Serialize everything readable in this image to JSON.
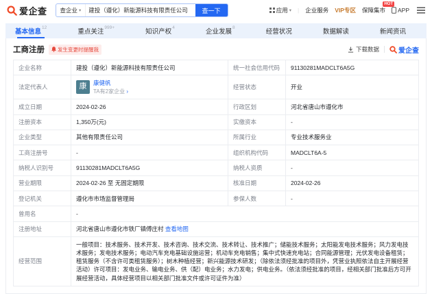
{
  "header": {
    "logo_text": "爱企查",
    "search": {
      "category": "查企业",
      "value": "建投（遵化）新能源科技有限责任公司",
      "button": "查一下"
    },
    "nav": {
      "apps": "应用",
      "enterprise": "企业服务",
      "vip": "VIP专区",
      "market": "保障集市",
      "market_badge": "HOT",
      "app": "APP"
    }
  },
  "tabs": [
    {
      "label": "基本信息",
      "count": "12",
      "active": true
    },
    {
      "label": "重点关注",
      "count": "999+",
      "active": false
    },
    {
      "label": "知识产权",
      "count": "4",
      "active": false
    },
    {
      "label": "企业发展",
      "count": "8",
      "active": false
    },
    {
      "label": "经营状况",
      "count": "",
      "active": false
    },
    {
      "label": "数据解读",
      "count": "",
      "active": false
    },
    {
      "label": "新闻资讯",
      "count": "",
      "active": false
    }
  ],
  "section": {
    "title": "工商注册",
    "reminder": "发生变更时提醒我",
    "download": "下载数据",
    "brand": "爱企查"
  },
  "registration": {
    "rows": [
      [
        {
          "kind": "label",
          "text": "企业名称"
        },
        {
          "kind": "text",
          "text": "建投（遵化）新能源科技有限责任公司"
        },
        {
          "kind": "label",
          "text": "统一社会信用代码"
        },
        {
          "kind": "text",
          "text": "91130281MADCLT6A5G"
        }
      ],
      [
        {
          "kind": "label",
          "text": "法定代表人"
        },
        {
          "kind": "person",
          "avatar": "康",
          "name": "康健帆",
          "sub": "TA有2家企业"
        },
        {
          "kind": "label",
          "text": "经营状态"
        },
        {
          "kind": "text",
          "text": "开业"
        }
      ],
      [
        {
          "kind": "label",
          "text": "成立日期"
        },
        {
          "kind": "text",
          "text": "2024-02-26"
        },
        {
          "kind": "label",
          "text": "行政区划"
        },
        {
          "kind": "text",
          "text": "河北省唐山市遵化市"
        }
      ],
      [
        {
          "kind": "label",
          "text": "注册资本"
        },
        {
          "kind": "text",
          "text": "1,350万(元)"
        },
        {
          "kind": "label",
          "text": "实缴资本"
        },
        {
          "kind": "text",
          "text": "-"
        }
      ],
      [
        {
          "kind": "label",
          "text": "企业类型"
        },
        {
          "kind": "text",
          "text": "其他有限责任公司"
        },
        {
          "kind": "label",
          "text": "所属行业"
        },
        {
          "kind": "text",
          "text": "专业技术服务业"
        }
      ],
      [
        {
          "kind": "label",
          "text": "工商注册号"
        },
        {
          "kind": "text",
          "text": "-"
        },
        {
          "kind": "label",
          "text": "组织机构代码"
        },
        {
          "kind": "text",
          "text": "MADCLT6A-5"
        }
      ],
      [
        {
          "kind": "label",
          "text": "纳税人识别号"
        },
        {
          "kind": "text",
          "text": "91130281MADCLT6A5G"
        },
        {
          "kind": "label",
          "text": "纳税人资质"
        },
        {
          "kind": "text",
          "text": "-"
        }
      ],
      [
        {
          "kind": "label",
          "text": "营业期限"
        },
        {
          "kind": "text",
          "text": "2024-02-26 至 无固定期限"
        },
        {
          "kind": "label",
          "text": "核准日期"
        },
        {
          "kind": "text",
          "text": "2024-02-26"
        }
      ],
      [
        {
          "kind": "label",
          "text": "登记机关"
        },
        {
          "kind": "text",
          "text": "遵化市市场监督管理局"
        },
        {
          "kind": "label",
          "text": "参保人数"
        },
        {
          "kind": "text",
          "text": "-"
        }
      ],
      [
        {
          "kind": "label",
          "text": "曾用名"
        },
        {
          "kind": "text",
          "text": "-",
          "colspan": 3
        }
      ],
      [
        {
          "kind": "label",
          "text": "注册地址"
        },
        {
          "kind": "text-link",
          "text": "河北省唐山市遵化市铁厂镇傅庄村",
          "link": "查看地图",
          "colspan": 3
        }
      ],
      [
        {
          "kind": "label",
          "text": "经营范围"
        },
        {
          "kind": "text",
          "text": "一般项目：技术服务、技术开发、技术咨询、技术交流、技术转让、技术推广；储能技术服务；太阳能发电技术服务；风力发电技术服务；发电技术服务；电动汽车充电基础设施运营；机动车充电销售；集中式快速充电站；合同能源管理；光伏发电设备租赁；租赁服务（不含许可类租赁服务）；树木种植经营；新兴能源技术研发；（除依法须经批准的项目外，凭营业执照依法自主开展经营活动）许可项目：发电业务、输电业务、供（配）电业务；水力发电；供电业务。（依法须经批准的项目，经相关部门批准后方可开展经营活动，具体经营项目以相关部门批准文件或许可证件为准）",
          "colspan": 3
        }
      ]
    ]
  }
}
